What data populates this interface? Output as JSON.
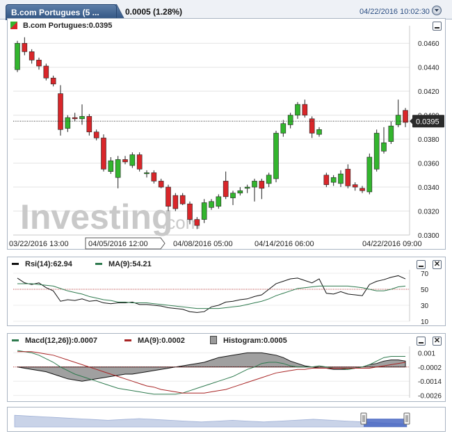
{
  "header": {
    "tab_title": "B.com Portugues (5 ...",
    "price_change": "0.0005 (1.28%)",
    "datetime": "04/22/2016 10:02:30"
  },
  "main_panel": {
    "legend": "B.com Portugues:0.0395",
    "last_price_label": "0.0395",
    "watermark": "Investing",
    "watermark_suffix": ".com"
  },
  "rsi_panel": {
    "rsi_label": "Rsi(14):62.94",
    "ma_label": "MA(9):54.21"
  },
  "macd_panel": {
    "macd_label": "Macd(12,26)):0.0007",
    "ma_label": "MA(9):0.0002",
    "hist_label": "Histogram:0.0005"
  },
  "colors": {
    "up": "#33b52e",
    "down": "#d9262a",
    "rsi_line": "#111111",
    "ma_line": "#2e7a4e",
    "macd_ma_line": "#a82424",
    "ref_line": "#c83c3c",
    "hist_fill": "#a0a0a0",
    "navigator_fill": "#c9d3e8",
    "navigator_highlight": "#3f5fbf"
  },
  "chart_data": [
    {
      "type": "candlestick",
      "ylim": [
        0.03,
        0.047
      ],
      "yticks": [
        "0.0460",
        "0.0440",
        "0.0420",
        "0.0400",
        "0.0380",
        "0.0360",
        "0.0340",
        "0.0320",
        "0.0300"
      ],
      "xticks": [
        "03/22/2016 13:00",
        "04/05/2016 12:00",
        "04/08/2016 05:00",
        "04/14/2016 06:00",
        "04/22/2016 09:00"
      ],
      "highlighted_xtick": "04/05/2016 12:00",
      "last_price": 0.0395,
      "candles": [
        [
          0.0438,
          0.046,
          0.0462,
          0.0436
        ],
        [
          0.046,
          0.0453,
          0.0465,
          0.045
        ],
        [
          0.0453,
          0.0446,
          0.0455,
          0.0443
        ],
        [
          0.0446,
          0.0441,
          0.0448,
          0.0438
        ],
        [
          0.0441,
          0.0431,
          0.0443,
          0.0429
        ],
        [
          0.0431,
          0.0426,
          0.0433,
          0.0424
        ],
        [
          0.0418,
          0.0388,
          0.0425,
          0.0383
        ],
        [
          0.0389,
          0.0398,
          0.04,
          0.0386
        ],
        [
          0.0398,
          0.0397,
          0.0402,
          0.0395
        ],
        [
          0.0397,
          0.0399,
          0.0409,
          0.0392
        ],
        [
          0.0399,
          0.0386,
          0.0401,
          0.0383
        ],
        [
          0.0386,
          0.0381,
          0.0388,
          0.0379
        ],
        [
          0.0381,
          0.0355,
          0.0384,
          0.0353
        ],
        [
          0.0353,
          0.0362,
          0.0365,
          0.0351
        ],
        [
          0.0348,
          0.0363,
          0.0366,
          0.0339
        ],
        [
          0.0363,
          0.0361,
          0.0366,
          0.0359
        ],
        [
          0.0358,
          0.0367,
          0.0369,
          0.0356
        ],
        [
          0.0367,
          0.0355,
          0.0369,
          0.0353
        ],
        [
          0.0352,
          0.0352,
          0.0354,
          0.0348
        ],
        [
          0.0352,
          0.0345,
          0.0354,
          0.0343
        ],
        [
          0.0345,
          0.034,
          0.0347,
          0.0339
        ],
        [
          0.034,
          0.0324,
          0.0342,
          0.032
        ],
        [
          0.0333,
          0.0322,
          0.0335,
          0.032
        ],
        [
          0.0333,
          0.0326,
          0.0335,
          0.0325
        ],
        [
          0.0326,
          0.0313,
          0.0328,
          0.0309
        ],
        [
          0.0313,
          0.0308,
          0.0315,
          0.0305
        ],
        [
          0.0313,
          0.0327,
          0.033,
          0.031
        ],
        [
          0.0323,
          0.0328,
          0.033,
          0.0321
        ],
        [
          0.0324,
          0.0332,
          0.0334,
          0.0322
        ],
        [
          0.0345,
          0.0332,
          0.0353,
          0.033
        ],
        [
          0.0331,
          0.0335,
          0.0337,
          0.0325
        ],
        [
          0.0335,
          0.0337,
          0.034,
          0.0333
        ],
        [
          0.0339,
          0.034,
          0.0342,
          0.0335
        ],
        [
          0.034,
          0.0345,
          0.0347,
          0.0328
        ],
        [
          0.0345,
          0.0339,
          0.0347,
          0.033
        ],
        [
          0.0343,
          0.035,
          0.0352,
          0.034
        ],
        [
          0.0347,
          0.0385,
          0.0387,
          0.0344
        ],
        [
          0.0385,
          0.0393,
          0.0396,
          0.0382
        ],
        [
          0.0392,
          0.04,
          0.0402,
          0.0389
        ],
        [
          0.04,
          0.0409,
          0.0411,
          0.0397
        ],
        [
          0.0409,
          0.04,
          0.0413,
          0.0398
        ],
        [
          0.0397,
          0.0385,
          0.0399,
          0.0381
        ],
        [
          0.0384,
          0.0388,
          0.039,
          0.0382
        ],
        [
          0.035,
          0.0342,
          0.0352,
          0.034
        ],
        [
          0.0344,
          0.0348,
          0.035,
          0.0341
        ],
        [
          0.0343,
          0.0351,
          0.0354,
          0.034
        ],
        [
          0.0355,
          0.0341,
          0.0359,
          0.0339
        ],
        [
          0.0342,
          0.034,
          0.0344,
          0.0337
        ],
        [
          0.0339,
          0.0337,
          0.0341,
          0.0335
        ],
        [
          0.0336,
          0.0365,
          0.0368,
          0.0334
        ],
        [
          0.0355,
          0.0385,
          0.0388,
          0.0353
        ],
        [
          0.037,
          0.0377,
          0.039,
          0.0368
        ],
        [
          0.0378,
          0.0391,
          0.0395,
          0.0376
        ],
        [
          0.0392,
          0.04,
          0.0413,
          0.039
        ],
        [
          0.0404,
          0.0394,
          0.0406,
          0.039
        ]
      ]
    },
    {
      "type": "line",
      "ylim": [
        10,
        70
      ],
      "yticks": [
        "70",
        "50",
        "30",
        "10"
      ],
      "ref": 50,
      "series": [
        {
          "name": "Rsi(14)",
          "values": [
            64,
            58,
            56,
            58,
            52,
            48,
            35,
            37,
            36,
            38,
            35,
            36,
            33,
            32,
            33,
            33,
            34,
            31,
            31,
            30,
            29,
            27,
            26,
            25,
            22,
            21,
            22,
            28,
            30,
            34,
            35,
            37,
            38,
            41,
            43,
            50,
            57,
            60,
            63,
            64,
            61,
            58,
            63,
            45,
            44,
            47,
            44,
            43,
            42,
            56,
            60,
            62,
            65,
            67,
            63
          ]
        },
        {
          "name": "MA(9)",
          "values": [
            57,
            57,
            57,
            56,
            55,
            54,
            51,
            48,
            46,
            44,
            41,
            39,
            37,
            36,
            34,
            34,
            33,
            33,
            33,
            32,
            31,
            30,
            29,
            28,
            27,
            26,
            26,
            26,
            26,
            27,
            28,
            29,
            31,
            33,
            35,
            38,
            42,
            45,
            48,
            51,
            52,
            53,
            54,
            54,
            54,
            54,
            54,
            53,
            52,
            50,
            48,
            48,
            50,
            53,
            54
          ]
        }
      ]
    },
    {
      "type": "line",
      "ylim": [
        -0.0028,
        0.0012
      ],
      "yticks": [
        "0.001",
        "-0.0002",
        "-0.0014",
        "-0.0026"
      ],
      "ref": -0.0002,
      "series": [
        {
          "name": "Macd(12,26))",
          "values": [
            0.0012,
            0.0011,
            0.001,
            0.0008,
            0.0005,
            0.0002,
            -0.0002,
            -0.0005,
            -0.0008,
            -0.001,
            -0.0012,
            -0.0014,
            -0.0016,
            -0.0018,
            -0.002,
            -0.0021,
            -0.0022,
            -0.0023,
            -0.0024,
            -0.0025,
            -0.0025,
            -0.0025,
            -0.0025,
            -0.0024,
            -0.0022,
            -0.002,
            -0.0018,
            -0.0016,
            -0.0014,
            -0.0012,
            -0.001,
            -0.0007,
            -0.0004,
            -0.0002,
            0.0001,
            0.0002,
            0.0002,
            0.0001,
            -0.0001,
            -0.0002,
            -0.0002,
            -0.0002,
            -0.0001,
            -0.0002,
            -0.0003,
            -0.0003,
            -0.0004,
            -0.0003,
            -0.0002,
            0.0,
            0.0003,
            0.0006,
            0.0007,
            0.0007,
            0.0007
          ]
        },
        {
          "name": "MA(9)",
          "values": [
            0.0011,
            0.0011,
            0.0011,
            0.001,
            0.0009,
            0.0008,
            0.0006,
            0.0004,
            0.0002,
            0.0,
            -0.0002,
            -0.0004,
            -0.0006,
            -0.0008,
            -0.001,
            -0.0012,
            -0.0014,
            -0.0016,
            -0.0018,
            -0.0019,
            -0.0021,
            -0.0022,
            -0.0023,
            -0.0024,
            -0.0024,
            -0.0024,
            -0.0024,
            -0.0023,
            -0.0022,
            -0.0021,
            -0.0019,
            -0.0017,
            -0.0015,
            -0.0013,
            -0.0011,
            -0.0009,
            -0.0007,
            -0.0006,
            -0.0005,
            -0.0004,
            -0.0004,
            -0.0003,
            -0.0003,
            -0.0003,
            -0.0003,
            -0.0003,
            -0.0003,
            -0.0003,
            -0.0003,
            -0.0003,
            -0.0002,
            -0.0001,
            0.0,
            0.0001,
            0.0002
          ]
        },
        {
          "name": "Histogram",
          "values": [
            0.0,
            -0.0001,
            -0.0002,
            -0.0003,
            -0.0004,
            -0.0006,
            -0.0008,
            -0.001,
            -0.0011,
            -0.0012,
            -0.0011,
            -0.001,
            -0.0009,
            -0.0008,
            -0.0007,
            -0.0006,
            -0.0006,
            -0.0005,
            -0.0004,
            -0.0003,
            -0.0002,
            -0.0001,
            0.0,
            0.0001,
            0.0002,
            0.0003,
            0.0004,
            0.0006,
            0.0008,
            0.0009,
            0.001,
            0.0011,
            0.0012,
            0.0012,
            0.0012,
            0.0011,
            0.001,
            0.0008,
            0.0005,
            0.0003,
            0.0001,
            0.0,
            -0.0001,
            -0.0001,
            -0.0002,
            -0.0002,
            -0.0002,
            -0.0001,
            0.0,
            0.0002,
            0.0003,
            0.0005,
            0.0006,
            0.0006,
            0.0005
          ]
        }
      ]
    },
    {
      "type": "area",
      "values": [
        0.3,
        0.32,
        0.34,
        0.36,
        0.38,
        0.4,
        0.42,
        0.44,
        0.46,
        0.48,
        0.5,
        0.52,
        0.54,
        0.56,
        0.58,
        0.6,
        0.58,
        0.56,
        0.54,
        0.52,
        0.5,
        0.52,
        0.54,
        0.56,
        0.58,
        0.6,
        0.62,
        0.64,
        0.66,
        0.68,
        0.7,
        0.68,
        0.66,
        0.64,
        0.62,
        0.6,
        0.62,
        0.64,
        0.66,
        0.68,
        0.7,
        0.68,
        0.66,
        0.64,
        0.62,
        0.6,
        0.58,
        0.56,
        0.54,
        0.56,
        0.58,
        0.6,
        0.62,
        0.64,
        0.66,
        0.68,
        0.7,
        0.72,
        0.74,
        0.76,
        0.78,
        0.8,
        0.82,
        0.84
      ],
      "selection": [
        0.89,
        1.0
      ]
    }
  ]
}
